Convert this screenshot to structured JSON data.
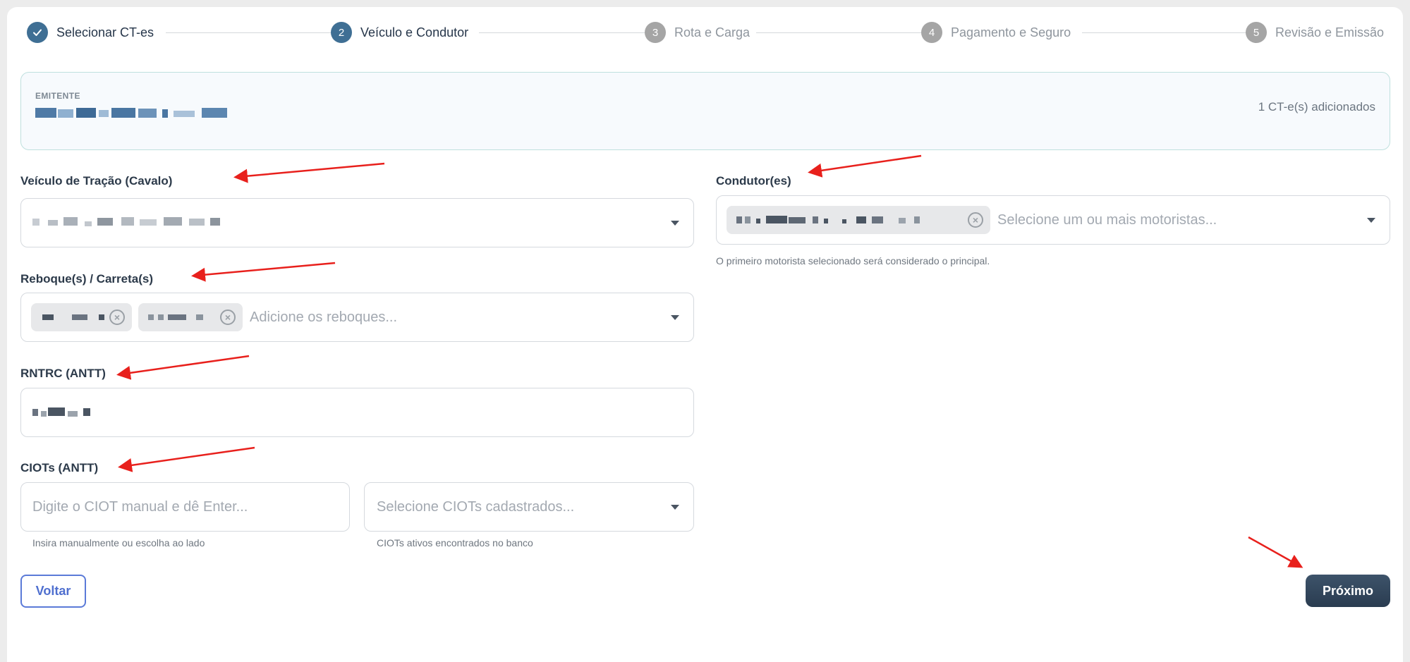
{
  "stepper": {
    "steps": [
      {
        "number": "✓",
        "label": "Selecionar CT-es",
        "state": "done"
      },
      {
        "number": "2",
        "label": "Veículo e Condutor",
        "state": "active"
      },
      {
        "number": "3",
        "label": "Rota e Carga",
        "state": "pending"
      },
      {
        "number": "4",
        "label": "Pagamento e Seguro",
        "state": "pending"
      },
      {
        "number": "5",
        "label": "Revisão e Emissão",
        "state": "pending"
      }
    ]
  },
  "emitter": {
    "label": "EMITENTE",
    "count_text": "1 CT-e(s) adicionados"
  },
  "vehicle": {
    "label": "Veículo de Tração (Cavalo)"
  },
  "trailers": {
    "label": "Reboque(s) / Carreta(s)",
    "placeholder": "Adicione os reboques..."
  },
  "rntrc": {
    "label": "RNTRC (ANTT)"
  },
  "ciots": {
    "label": "CIOTs (ANTT)",
    "manual_placeholder": "Digite o CIOT manual e dê Enter...",
    "manual_help": "Insira manualmente ou escolha ao lado",
    "select_placeholder": "Selecione CIOTs cadastrados...",
    "select_help": "CIOTs ativos encontrados no banco"
  },
  "drivers": {
    "label": "Condutor(es)",
    "placeholder": "Selecione um ou mais motoristas...",
    "help": "O primeiro motorista selecionado será considerado o principal."
  },
  "actions": {
    "back_label": "Voltar",
    "next_label": "Próximo"
  },
  "colors": {
    "primary": "#3f6f94",
    "annotation_arrow": "#e8201c"
  }
}
